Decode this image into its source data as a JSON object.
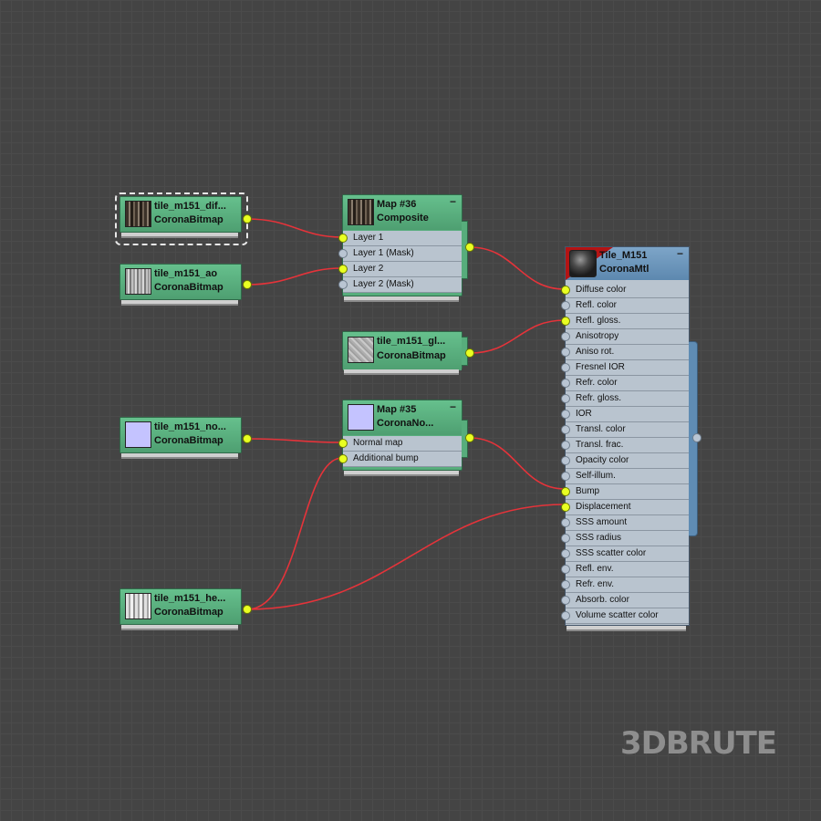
{
  "nodes": {
    "diffuse": {
      "name": "tile_m151_dif...",
      "type": "CoronaBitmap"
    },
    "ao": {
      "name": "tile_m151_ao",
      "type": "CoronaBitmap"
    },
    "composite": {
      "name": "Map #36",
      "type": "Composite",
      "rows": [
        "Layer 1",
        "Layer 1 (Mask)",
        "Layer 2",
        "Layer 2 (Mask)"
      ]
    },
    "gloss": {
      "name": "tile_m151_gl...",
      "type": "CoronaBitmap"
    },
    "normal": {
      "name": "tile_m151_no...",
      "type": "CoronaBitmap"
    },
    "normalmap": {
      "name": "Map #35",
      "type": "CoronaNo...",
      "rows": [
        "Normal map",
        "Additional bump"
      ]
    },
    "height": {
      "name": "tile_m151_he...",
      "type": "CoronaBitmap"
    },
    "material": {
      "name": "Tile_M151",
      "type": "CoronaMtl",
      "rows": [
        "Diffuse color",
        "Refl. color",
        "Refl. gloss.",
        "Anisotropy",
        "Aniso rot.",
        "Fresnel IOR",
        "Refr. color",
        "Refr. gloss.",
        "IOR",
        "Transl. color",
        "Transl. frac.",
        "Opacity color",
        "Self-illum.",
        "Bump",
        "Displacement",
        "SSS amount",
        "SSS radius",
        "SSS scatter color",
        "Refl. env.",
        "Refr. env.",
        "Absorb. color",
        "Volume scatter color"
      ],
      "connected": [
        "Diffuse color",
        "Refl. gloss.",
        "Bump",
        "Displacement"
      ]
    }
  },
  "minus_symbol": "−",
  "watermark": "3DBRUTE",
  "colors": {
    "wire": "#e5333a",
    "port_active": "#e9ff22",
    "node_green": "#57ad7c",
    "node_blue": "#5d88af"
  }
}
